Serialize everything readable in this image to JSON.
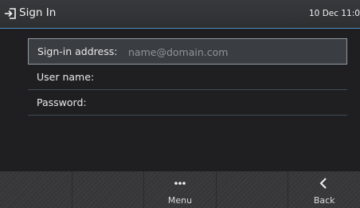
{
  "header": {
    "title": "Sign In",
    "datetime": "10 Dec 11:0",
    "icon": "sign-in-icon"
  },
  "form": {
    "signin_address": {
      "label": "Sign-in address:",
      "placeholder": "name@domain.com",
      "value": ""
    },
    "username": {
      "label": "User name:",
      "value": ""
    },
    "password": {
      "label": "Password:",
      "value": ""
    }
  },
  "softkeys": {
    "menu": {
      "label": "Menu",
      "icon": "more-icon"
    },
    "back": {
      "label": "Back",
      "icon": "chevron-left-icon"
    }
  },
  "colors": {
    "header_divider": "#4f8dbe",
    "background": "#1f1f21",
    "selected_row": "#3a3e42"
  }
}
